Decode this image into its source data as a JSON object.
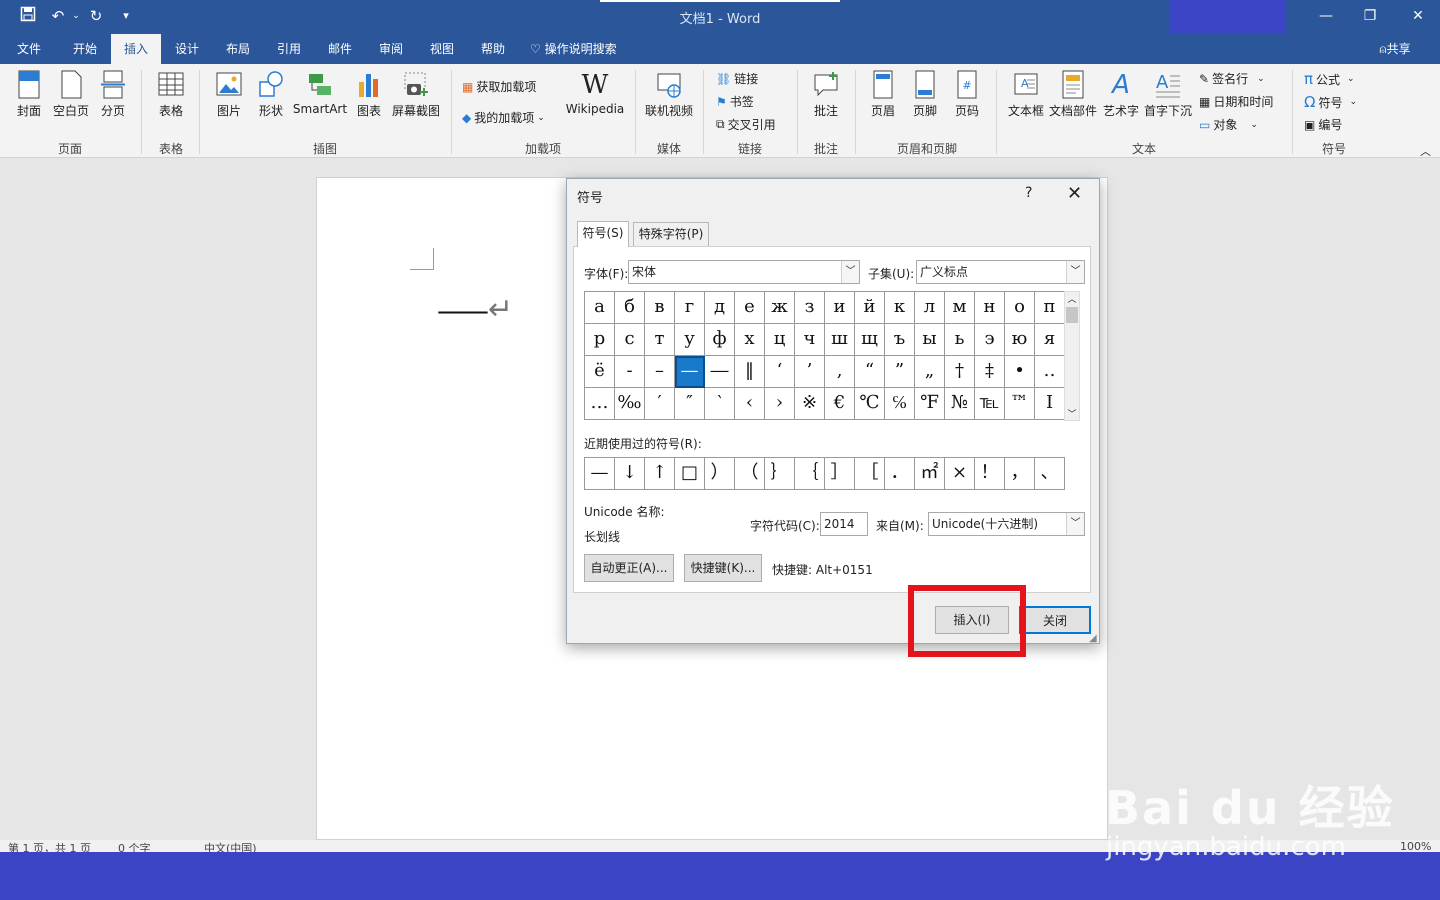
{
  "titlebar": {
    "title": "文档1",
    "separator": "-",
    "app": "Word"
  },
  "quick_access": {
    "save_icon": "save-icon",
    "undo_icon": "undo-icon",
    "redo_icon": "redo-icon",
    "customize_icon": "customize-icon"
  },
  "window_controls": {
    "minimize": "—",
    "restore": "❐",
    "close": "✕"
  },
  "tabs": [
    {
      "label": "文件"
    },
    {
      "label": "开始"
    },
    {
      "label": "插入"
    },
    {
      "label": "设计"
    },
    {
      "label": "布局"
    },
    {
      "label": "引用"
    },
    {
      "label": "邮件"
    },
    {
      "label": "审阅"
    },
    {
      "label": "视图"
    },
    {
      "label": "帮助"
    }
  ],
  "tell_me": "操作说明搜索",
  "share": "共享",
  "ribbon": {
    "page_group": {
      "label": "页面",
      "cover": "封面",
      "blank": "空白页",
      "break": "分页"
    },
    "table_group": {
      "label": "表格",
      "table": "表格"
    },
    "illustrations": {
      "label": "插图",
      "picture": "图片",
      "shape": "形状",
      "smartart": "SmartArt",
      "chart": "图表",
      "screenshot": "屏幕截图"
    },
    "addins": {
      "label": "加载项",
      "get": "获取加载项",
      "mine": "我的加载项",
      "wikipedia": "Wikipedia"
    },
    "media": {
      "label": "媒体",
      "video": "联机视频"
    },
    "links": {
      "label": "链接",
      "link": "链接",
      "bookmark": "书签",
      "crossref": "交叉引用"
    },
    "comments": {
      "label": "批注",
      "comment": "批注"
    },
    "headerfooter": {
      "label": "页眉和页脚",
      "header": "页眉",
      "footer": "页脚",
      "pagenum": "页码"
    },
    "text": {
      "label": "文本",
      "textbox": "文本框",
      "quickparts": "文档部件",
      "wordart": "艺术字",
      "dropcap": "首字下沉",
      "signature": "签名行",
      "datetime": "日期和时间",
      "object": "对象"
    },
    "symbols": {
      "label": "符号",
      "equation": "公式",
      "symbol": "符号",
      "number": "编号"
    }
  },
  "document": {
    "dash_text": "——",
    "return_mark": "↵"
  },
  "dialog": {
    "title": "符号",
    "help": "?",
    "close": "✕",
    "tab_symbols": "符号(S)",
    "tab_special": "特殊字符(P)",
    "font_label": "字体(F):",
    "font_value": "宋体",
    "subset_label": "子集(U):",
    "subset_value": "广义标点",
    "grid": [
      [
        "а",
        "б",
        "в",
        "г",
        "д",
        "е",
        "ж",
        "з",
        "и",
        "й",
        "к",
        "л",
        "м",
        "н",
        "о",
        "п"
      ],
      [
        "р",
        "с",
        "т",
        "у",
        "ф",
        "х",
        "ц",
        "ч",
        "ш",
        "щ",
        "ъ",
        "ы",
        "ь",
        "э",
        "ю",
        "я"
      ],
      [
        "ё",
        "‐",
        "–",
        "—",
        "―",
        "‖",
        "‘",
        "’",
        "‚",
        "“",
        "”",
        "„",
        "†",
        "‡",
        "•",
        "‥"
      ],
      [
        "…",
        "‰",
        "′",
        "″",
        "‵",
        "‹",
        "›",
        "※",
        "€",
        "℃",
        "℅",
        "℉",
        "№",
        "℡",
        "™",
        "Ⅰ"
      ]
    ],
    "selected": {
      "row": 2,
      "col": 3
    },
    "recent_label": "近期使用过的符号(R):",
    "recent": [
      "—",
      "↓",
      "↑",
      "□",
      "）",
      "（",
      "｝",
      "｛",
      "］",
      "［",
      "．",
      "㎡",
      "×",
      "！",
      "，",
      "、"
    ],
    "unicode_name_label": "Unicode 名称:",
    "unicode_name": "长划线",
    "code_label": "字符代码(C):",
    "code_value": "2014",
    "from_label": "来自(M):",
    "from_value": "Unicode(十六进制)",
    "autocorrect": "自动更正(A)...",
    "shortcut_btn": "快捷键(K)...",
    "shortcut_text": "快捷键: Alt+0151",
    "insert": "插入(I)",
    "close_btn": "关闭"
  },
  "status": {
    "page": "第 1 页，共 1 页",
    "words": "0 个字",
    "lang": "中文(中国)",
    "zoom": "100%"
  },
  "watermark": {
    "brand": "Bai du 经验",
    "url": "jingyan.baidu.com"
  },
  "colors": {
    "word_blue": "#2b579a",
    "highlight": "#e3141c",
    "band": "#3b44c4"
  }
}
